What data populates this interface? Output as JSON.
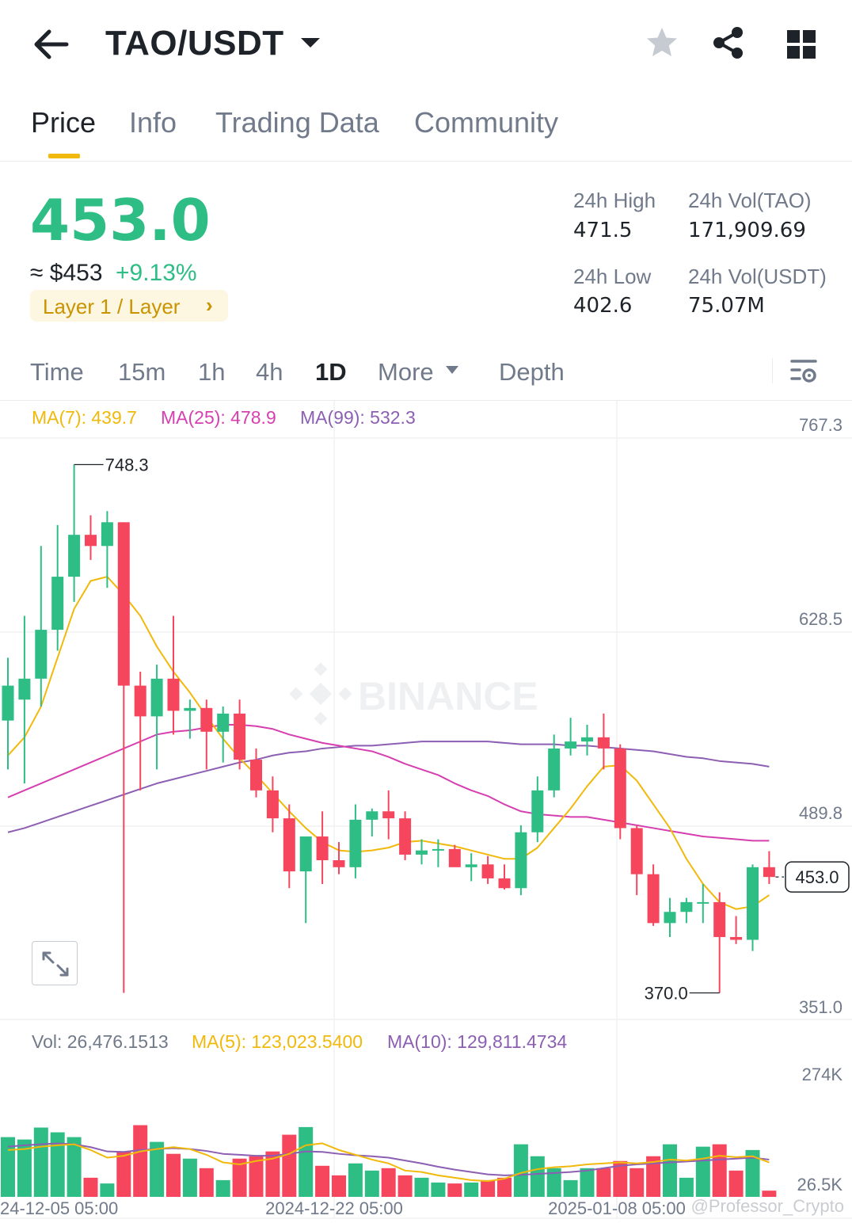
{
  "header": {
    "pair": "TAO/USDT",
    "icons": [
      "back-arrow-icon",
      "caret-down-icon",
      "star-icon",
      "share-icon",
      "grid-icon"
    ]
  },
  "tabs": [
    {
      "label": "Price",
      "active": true
    },
    {
      "label": "Info",
      "active": false
    },
    {
      "label": "Trading Data",
      "active": false
    },
    {
      "label": "Community",
      "active": false
    }
  ],
  "price": {
    "last": "453.0",
    "usd": "≈ $453",
    "change": "+9.13%",
    "tag": "Layer 1 / Layer",
    "tag_chevron": "›"
  },
  "stats": {
    "high_label": "24h High",
    "high": "471.5",
    "low_label": "24h Low",
    "low": "402.6",
    "vol_tao_label": "24h Vol(TAO)",
    "vol_tao": "171,909.69",
    "vol_usdt_label": "24h Vol(USDT)",
    "vol_usdt": "75.07M"
  },
  "intervals": {
    "items": [
      "Time",
      "15m",
      "1h",
      "4h",
      "1D",
      "More",
      "Depth"
    ],
    "active": "1D"
  },
  "ma_legend": {
    "ma7": "MA(7): 439.7",
    "ma25": "MA(25): 478.9",
    "ma99": "MA(99): 532.3"
  },
  "vol_legend": {
    "vol": "Vol: 26,476.1513",
    "ma5": "MA(5): 123,023.5400",
    "ma10": "MA(10): 129,811.4734"
  },
  "colors": {
    "up": "#2ebd85",
    "down": "#f6465d",
    "ma7": "#f0b90b",
    "ma25": "#d63fb0",
    "ma99": "#8c5fb3",
    "vol_ma5": "#f0b90b",
    "vol_ma10": "#8c5fb3"
  },
  "chart_data": {
    "type": "candlestick",
    "price_axis": [
      "767.3",
      "628.5",
      "489.8",
      "351.0"
    ],
    "volume_axis": [
      "274K",
      "26.5K"
    ],
    "x_labels": [
      "24-12-05 05:00",
      "2024-12-22 05:00",
      "2025-01-08 05:00"
    ],
    "high_label": "748.3",
    "low_label": "370.0",
    "last_label": "453.0",
    "watermark": "BINANCE",
    "credit": "@Professor_Crypto",
    "ylim": [
      351.0,
      767.3
    ],
    "vol_ylim": [
      0,
      290000
    ],
    "candles": [
      {
        "o": 565,
        "h": 610,
        "l": 530,
        "c": 590
      },
      {
        "o": 580,
        "h": 640,
        "l": 520,
        "c": 595
      },
      {
        "o": 595,
        "h": 690,
        "l": 575,
        "c": 630
      },
      {
        "o": 630,
        "h": 705,
        "l": 615,
        "c": 668
      },
      {
        "o": 668,
        "h": 748.3,
        "l": 650,
        "c": 698
      },
      {
        "o": 698,
        "h": 712,
        "l": 680,
        "c": 690
      },
      {
        "o": 690,
        "h": 715,
        "l": 660,
        "c": 707
      },
      {
        "o": 707,
        "h": 707,
        "l": 370,
        "c": 590
      },
      {
        "o": 590,
        "h": 600,
        "l": 515,
        "c": 568
      },
      {
        "o": 568,
        "h": 605,
        "l": 530,
        "c": 595
      },
      {
        "o": 595,
        "h": 640,
        "l": 555,
        "c": 572
      },
      {
        "o": 572,
        "h": 580,
        "l": 552,
        "c": 574
      },
      {
        "o": 574,
        "h": 580,
        "l": 530,
        "c": 557
      },
      {
        "o": 557,
        "h": 575,
        "l": 535,
        "c": 570
      },
      {
        "o": 570,
        "h": 580,
        "l": 530,
        "c": 537
      },
      {
        "o": 537,
        "h": 545,
        "l": 510,
        "c": 515
      },
      {
        "o": 515,
        "h": 525,
        "l": 485,
        "c": 495
      },
      {
        "o": 495,
        "h": 505,
        "l": 445,
        "c": 457
      },
      {
        "o": 457,
        "h": 465,
        "l": 420,
        "c": 482
      },
      {
        "o": 482,
        "h": 500,
        "l": 448,
        "c": 465
      },
      {
        "o": 465,
        "h": 478,
        "l": 455,
        "c": 460
      },
      {
        "o": 460,
        "h": 505,
        "l": 452,
        "c": 494
      },
      {
        "o": 494,
        "h": 502,
        "l": 482,
        "c": 500
      },
      {
        "o": 500,
        "h": 515,
        "l": 480,
        "c": 495
      },
      {
        "o": 495,
        "h": 500,
        "l": 465,
        "c": 469
      },
      {
        "o": 469,
        "h": 480,
        "l": 462,
        "c": 472
      },
      {
        "o": 472,
        "h": 480,
        "l": 460,
        "c": 473
      },
      {
        "o": 473,
        "h": 476,
        "l": 462,
        "c": 460
      },
      {
        "o": 460,
        "h": 470,
        "l": 450,
        "c": 462
      },
      {
        "o": 462,
        "h": 468,
        "l": 448,
        "c": 452
      },
      {
        "o": 452,
        "h": 462,
        "l": 444,
        "c": 445
      },
      {
        "o": 445,
        "h": 490,
        "l": 440,
        "c": 485
      },
      {
        "o": 485,
        "h": 525,
        "l": 478,
        "c": 515
      },
      {
        "o": 515,
        "h": 555,
        "l": 510,
        "c": 545
      },
      {
        "o": 545,
        "h": 567,
        "l": 540,
        "c": 550
      },
      {
        "o": 550,
        "h": 562,
        "l": 540,
        "c": 553
      },
      {
        "o": 553,
        "h": 570,
        "l": 530,
        "c": 545
      },
      {
        "o": 545,
        "h": 548,
        "l": 480,
        "c": 488
      },
      {
        "o": 488,
        "h": 490,
        "l": 440,
        "c": 455
      },
      {
        "o": 455,
        "h": 462,
        "l": 418,
        "c": 420
      },
      {
        "o": 420,
        "h": 438,
        "l": 410,
        "c": 428
      },
      {
        "o": 428,
        "h": 438,
        "l": 420,
        "c": 435
      },
      {
        "o": 435,
        "h": 448,
        "l": 420,
        "c": 435
      },
      {
        "o": 435,
        "h": 442,
        "l": 370,
        "c": 410
      },
      {
        "o": 410,
        "h": 425,
        "l": 405,
        "c": 408
      },
      {
        "o": 408,
        "h": 462,
        "l": 400,
        "c": 460
      },
      {
        "o": 460,
        "h": 471.5,
        "l": 448,
        "c": 453
      }
    ],
    "ma7": [
      540,
      553,
      575,
      610,
      645,
      665,
      668,
      655,
      640,
      618,
      600,
      585,
      568,
      552,
      538,
      526,
      513,
      500,
      488,
      478,
      472,
      471,
      472,
      474,
      478,
      479,
      477,
      475,
      472,
      469,
      466,
      466,
      474,
      488,
      502,
      518,
      532,
      533,
      522,
      505,
      488,
      466,
      448,
      435,
      430,
      432,
      440
    ],
    "ma25": [
      510,
      515,
      520,
      525,
      530,
      535,
      540,
      545,
      550,
      555,
      557,
      558,
      560,
      562,
      562,
      561,
      559,
      555,
      552,
      549,
      547,
      545,
      543,
      539,
      534,
      530,
      526,
      520,
      515,
      511,
      505,
      500,
      498,
      497,
      496,
      496,
      494,
      492,
      490,
      488,
      486,
      484,
      482,
      481,
      480,
      479,
      479
    ],
    "ma99": [
      485,
      488,
      492,
      496,
      500,
      504,
      508,
      512,
      516,
      520,
      523,
      526,
      529,
      532,
      535,
      537,
      540,
      542,
      543,
      545,
      546,
      547,
      547,
      548,
      549,
      550,
      550,
      550,
      550,
      550,
      549,
      548,
      548,
      548,
      547,
      547,
      546,
      545,
      544,
      543,
      541,
      539,
      538,
      536,
      535,
      534,
      532
    ],
    "volumes": [
      125000,
      120000,
      145000,
      135000,
      125000,
      40000,
      28000,
      95000,
      150000,
      115000,
      90000,
      80000,
      60000,
      35000,
      80000,
      85000,
      95000,
      130000,
      146000,
      65000,
      45000,
      70000,
      55000,
      60000,
      45000,
      40000,
      30000,
      28000,
      30000,
      35000,
      40000,
      110000,
      85000,
      60000,
      35000,
      60000,
      60000,
      75000,
      60000,
      85000,
      110000,
      40000,
      105000,
      110000,
      55000,
      98000,
      13000
    ],
    "vol_ma5": [
      98000,
      100000,
      105000,
      108000,
      110000,
      98000,
      82000,
      86000,
      95000,
      100000,
      104000,
      100000,
      88000,
      72000,
      68000,
      75000,
      80000,
      90000,
      108000,
      112000,
      98000,
      88000,
      78000,
      70000,
      55000,
      52000,
      45000,
      40000,
      35000,
      33000,
      38000,
      50000,
      58000,
      62000,
      64000,
      68000,
      70000,
      72000,
      70000,
      73000,
      78000,
      76000,
      80000,
      86000,
      83000,
      85000,
      72000
    ],
    "vol_ma10": [
      105000,
      108000,
      110000,
      112000,
      110000,
      104000,
      95000,
      94000,
      98000,
      100000,
      102000,
      100000,
      96000,
      90000,
      88000,
      86000,
      86000,
      90000,
      95000,
      94000,
      90000,
      87000,
      85000,
      82000,
      76000,
      70000,
      63000,
      57000,
      52000,
      47000,
      45000,
      46000,
      48000,
      50000,
      52000,
      55000,
      60000,
      65000,
      68000,
      70000,
      72000,
      74000,
      76000,
      78000,
      80000,
      82000,
      78000
    ]
  }
}
